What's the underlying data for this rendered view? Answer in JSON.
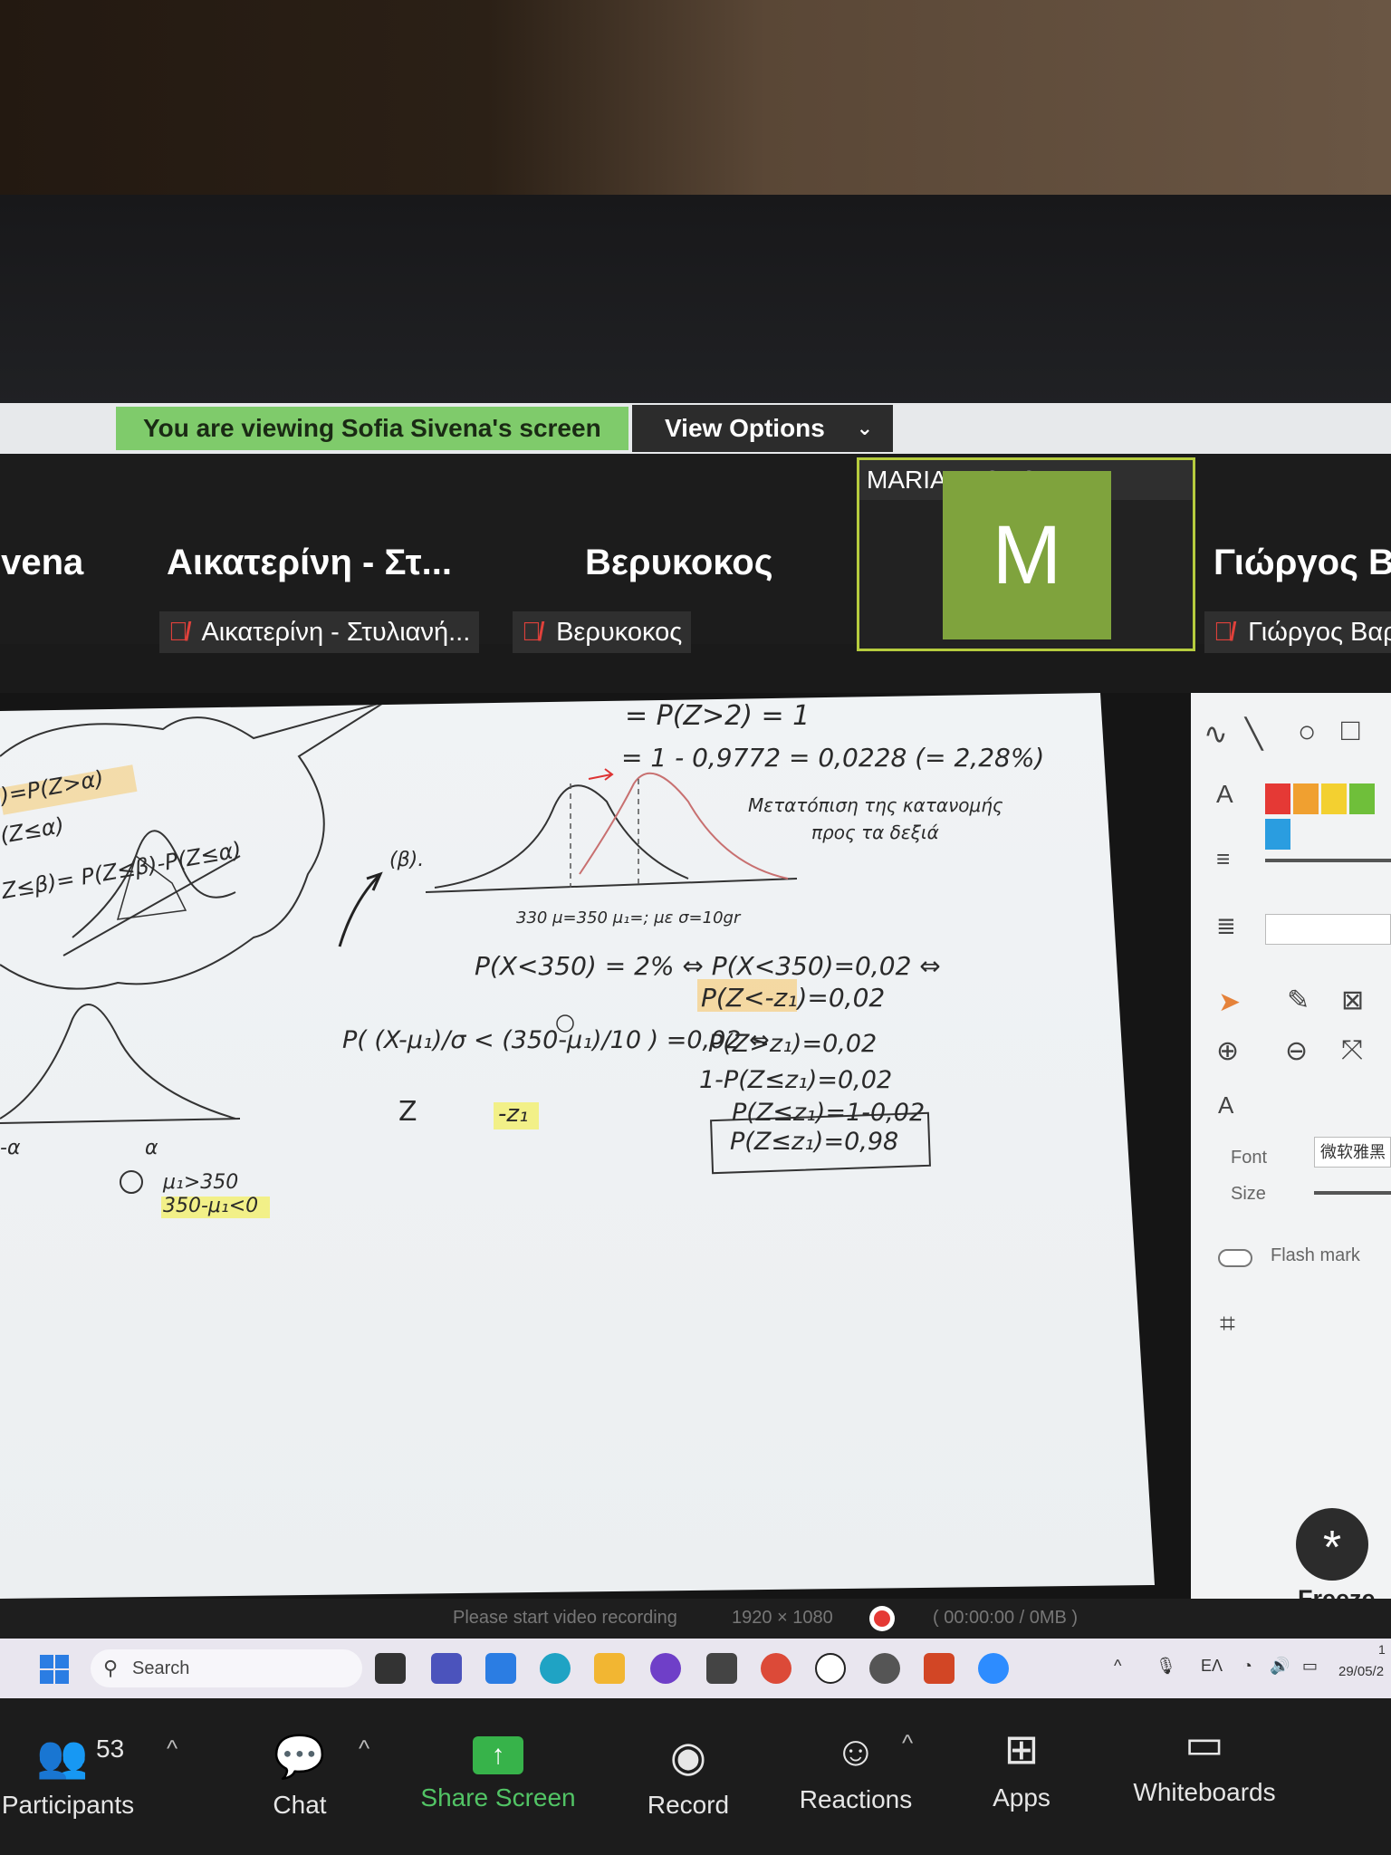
{
  "banner": {
    "viewing_text": "You are viewing Sofia Sivena's screen",
    "view_options_label": "View Options"
  },
  "participants": [
    {
      "big_name": "ivena",
      "tag": ""
    },
    {
      "big_name": "Αικατερίνη - Στ...",
      "tag": "Αικατερίνη - Στυλιανή..."
    },
    {
      "big_name": "Βερυκοκος",
      "tag": "Βερυκοκος"
    },
    {
      "avatar_letter": "M",
      "tag": "MARIA TACHOU"
    },
    {
      "big_name": "Γιώργος Β",
      "tag": "Γιώργος Βαρ"
    }
  ],
  "whiteboard": {
    "lines": [
      "= P(Z>2) = 1",
      "= 1 - 0,9772 = 0,0228 (= 2,28%)",
      "Μετατόπιση της κατανομής",
      "προς τα δεξιά",
      "(β).",
      "330  μ=350   μ₁=;    με σ=10gr",
      "P(X<350) = 2% ⇔ P(X<350)=0,02 ⇔",
      "P(Z<-z₁)=0,02",
      "P( (X-μ₁)/σ < (350-μ₁)/10 ) =0,02 ⇔",
      "P(Z>z₁)=0,02",
      "1-P(Z≤z₁)=0,02",
      "P(Z≤z₁)=1-0,02",
      "P(Z≤z₁)=0,98",
      "Z",
      "-z₁",
      "μ₁>350",
      "350-μ₁<0",
      ")=P(Z>α)",
      "(Z≤α)",
      "Z≤β)= P(Z≤β)-P(Z≤α)",
      "-α",
      "α"
    ]
  },
  "annotation": {
    "font_label": "Font",
    "font_value": "微软雅黑",
    "size_label": "Size",
    "flash_mark_label": "Flash mark",
    "freeze_label": "Freeze",
    "colors": [
      "#e53935",
      "#f0a030",
      "#f3d030",
      "#6fbf3a",
      "#2a9de0"
    ]
  },
  "recorder": {
    "prompt": "Please start video recording",
    "resolution": "1920 × 1080",
    "timer": "( 00:00:00 / 0MB )"
  },
  "taskbar": {
    "search_label": "Search",
    "lang": "ΕΛ",
    "time": "1",
    "date": "29/05/2"
  },
  "controls": {
    "participants_count": "53",
    "participants_label": "Participants",
    "chat_label": "Chat",
    "share_label": "Share Screen",
    "record_label": "Record",
    "reactions_label": "Reactions",
    "apps_label": "Apps",
    "whiteboards_label": "Whiteboards"
  }
}
